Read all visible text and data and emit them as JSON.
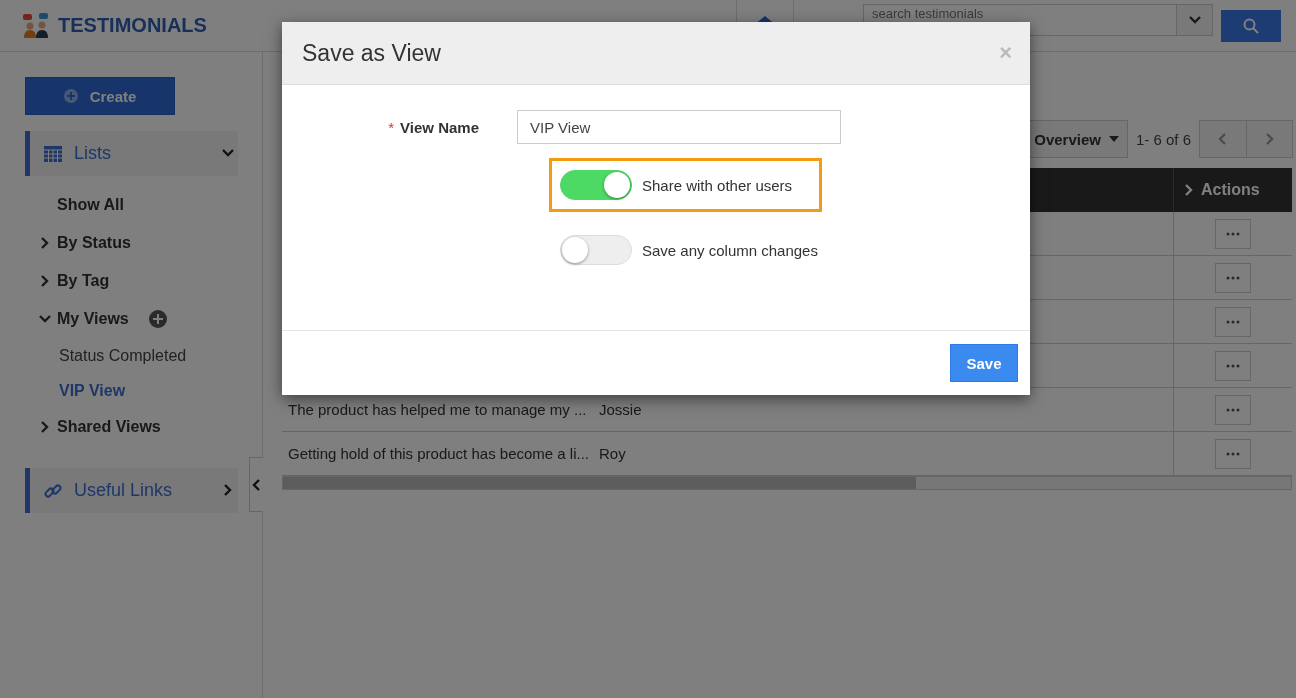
{
  "app": {
    "title": "TESTIMONIALS"
  },
  "search": {
    "placeholder": "search testimonials"
  },
  "sidebar": {
    "create_button": "Create",
    "lists": {
      "label": "Lists",
      "expanded": true,
      "items": [
        {
          "label": "Show All"
        },
        {
          "label": "By Status",
          "expanded": false
        },
        {
          "label": "By Tag",
          "expanded": false
        },
        {
          "label": "My Views",
          "expanded": true,
          "add_button": true,
          "children": [
            {
              "label": "Status Completed",
              "selected": false
            },
            {
              "label": "VIP View",
              "selected": true
            }
          ]
        },
        {
          "label": "Shared Views",
          "expanded": false
        }
      ]
    },
    "useful_links": {
      "label": "Useful Links",
      "expanded": false
    }
  },
  "toolbar": {
    "view_menu": "Overview",
    "pagination": "1- 6 of 6"
  },
  "table": {
    "actions_header": "Actions",
    "rows": [
      {
        "kind": "covered"
      },
      {
        "kind": "covered"
      },
      {
        "kind": "covered"
      },
      {
        "kind": "covered"
      },
      {
        "kind": "text",
        "testimonial": "The product has helped me to manage my ...",
        "author": "Jossie"
      },
      {
        "kind": "text",
        "testimonial": "Getting hold of this product has become a li...",
        "author": "Roy"
      }
    ]
  },
  "dialog": {
    "title": "Save as View",
    "close": "×",
    "field": {
      "label": "View Name",
      "required_mark": "*",
      "value": "VIP View"
    },
    "options": [
      {
        "label": "Share with other users",
        "on": true,
        "highlighted": true
      },
      {
        "label": "Save any column changes",
        "on": false,
        "highlighted": false
      }
    ],
    "save_button": "Save"
  }
}
